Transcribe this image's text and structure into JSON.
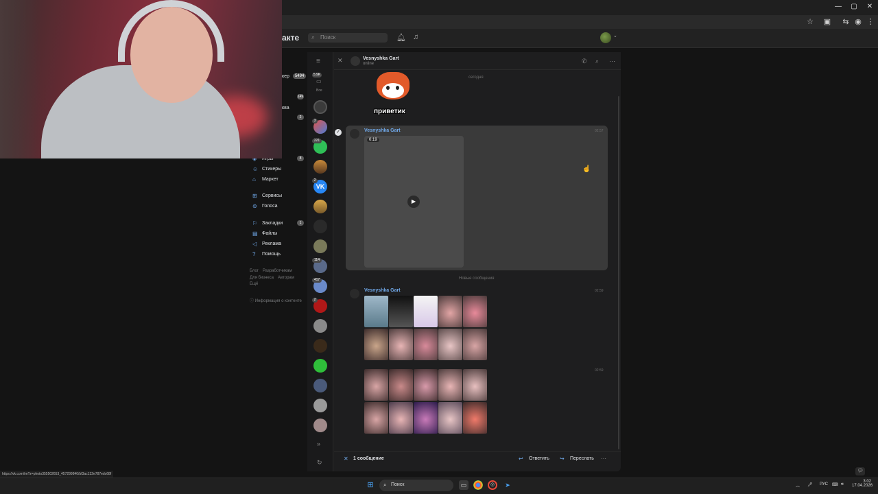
{
  "browser": {
    "window_controls": [
      "—",
      "▢",
      "✕"
    ],
    "toolbar_icons": [
      "star-icon",
      "extensions-icon",
      "tabs-icon",
      "profile-icon",
      "menu-icon"
    ]
  },
  "status_url": "https://vk.com/im?z=photo355502653_457299840/bf3ac132e787edc68f",
  "vk": {
    "logo_text": "акте",
    "search_placeholder": "Поиск",
    "menu": {
      "partial_top_1": "кер",
      "partial_top_1_badge": "5494",
      "partial_top_2_badge": "149",
      "partial_top_3": "ква",
      "partial_top_3_badge": "2",
      "partial_top_4_badge": "8",
      "items": [
        {
          "label": "Игры",
          "icon": "games-icon"
        },
        {
          "label": "Стикеры",
          "icon": "stickers-icon"
        },
        {
          "label": "Маркет",
          "icon": "market-icon"
        },
        {
          "label": "Сервисы",
          "icon": "services-icon"
        },
        {
          "label": "Голоса",
          "icon": "votes-icon"
        },
        {
          "label": "Закладки",
          "icon": "bookmarks-icon",
          "badge": "1"
        },
        {
          "label": "Файлы",
          "icon": "files-icon"
        },
        {
          "label": "Реклама",
          "icon": "ads-icon"
        },
        {
          "label": "Помощь",
          "icon": "help-icon"
        }
      ],
      "footer": {
        "blog": "Блог",
        "developers": "Разработчикам",
        "business": "Для бизнеса",
        "authors": "Авторам",
        "more": "Ещё",
        "info": "Информация о контенте"
      }
    }
  },
  "messenger": {
    "chat_list_label_all": "Все",
    "chat_list_count_top": "5.9K",
    "chat_counts": [
      "3",
      "221",
      "2",
      "114",
      "417",
      "2"
    ],
    "chat_name": "Vesnyshka Gart",
    "chat_status": "online",
    "date_separator": "сегодня",
    "sticker_text": "приветик",
    "messages": [
      {
        "author": "Vesnyshka Gart",
        "time": "02:57",
        "video_duration": "0:19"
      },
      {
        "author": "Vesnyshka Gart",
        "time": "02:59"
      },
      {
        "time": "02:59"
      }
    ],
    "new_messages_separator": "Новые сообщения",
    "bottom_bar": {
      "count": "1 сообщение",
      "reply": "Ответить",
      "forward": "Переслать"
    }
  },
  "taskbar": {
    "search_label": "Поиск",
    "lang": "РУС",
    "time": "3:02",
    "date": "17.04.2026"
  }
}
